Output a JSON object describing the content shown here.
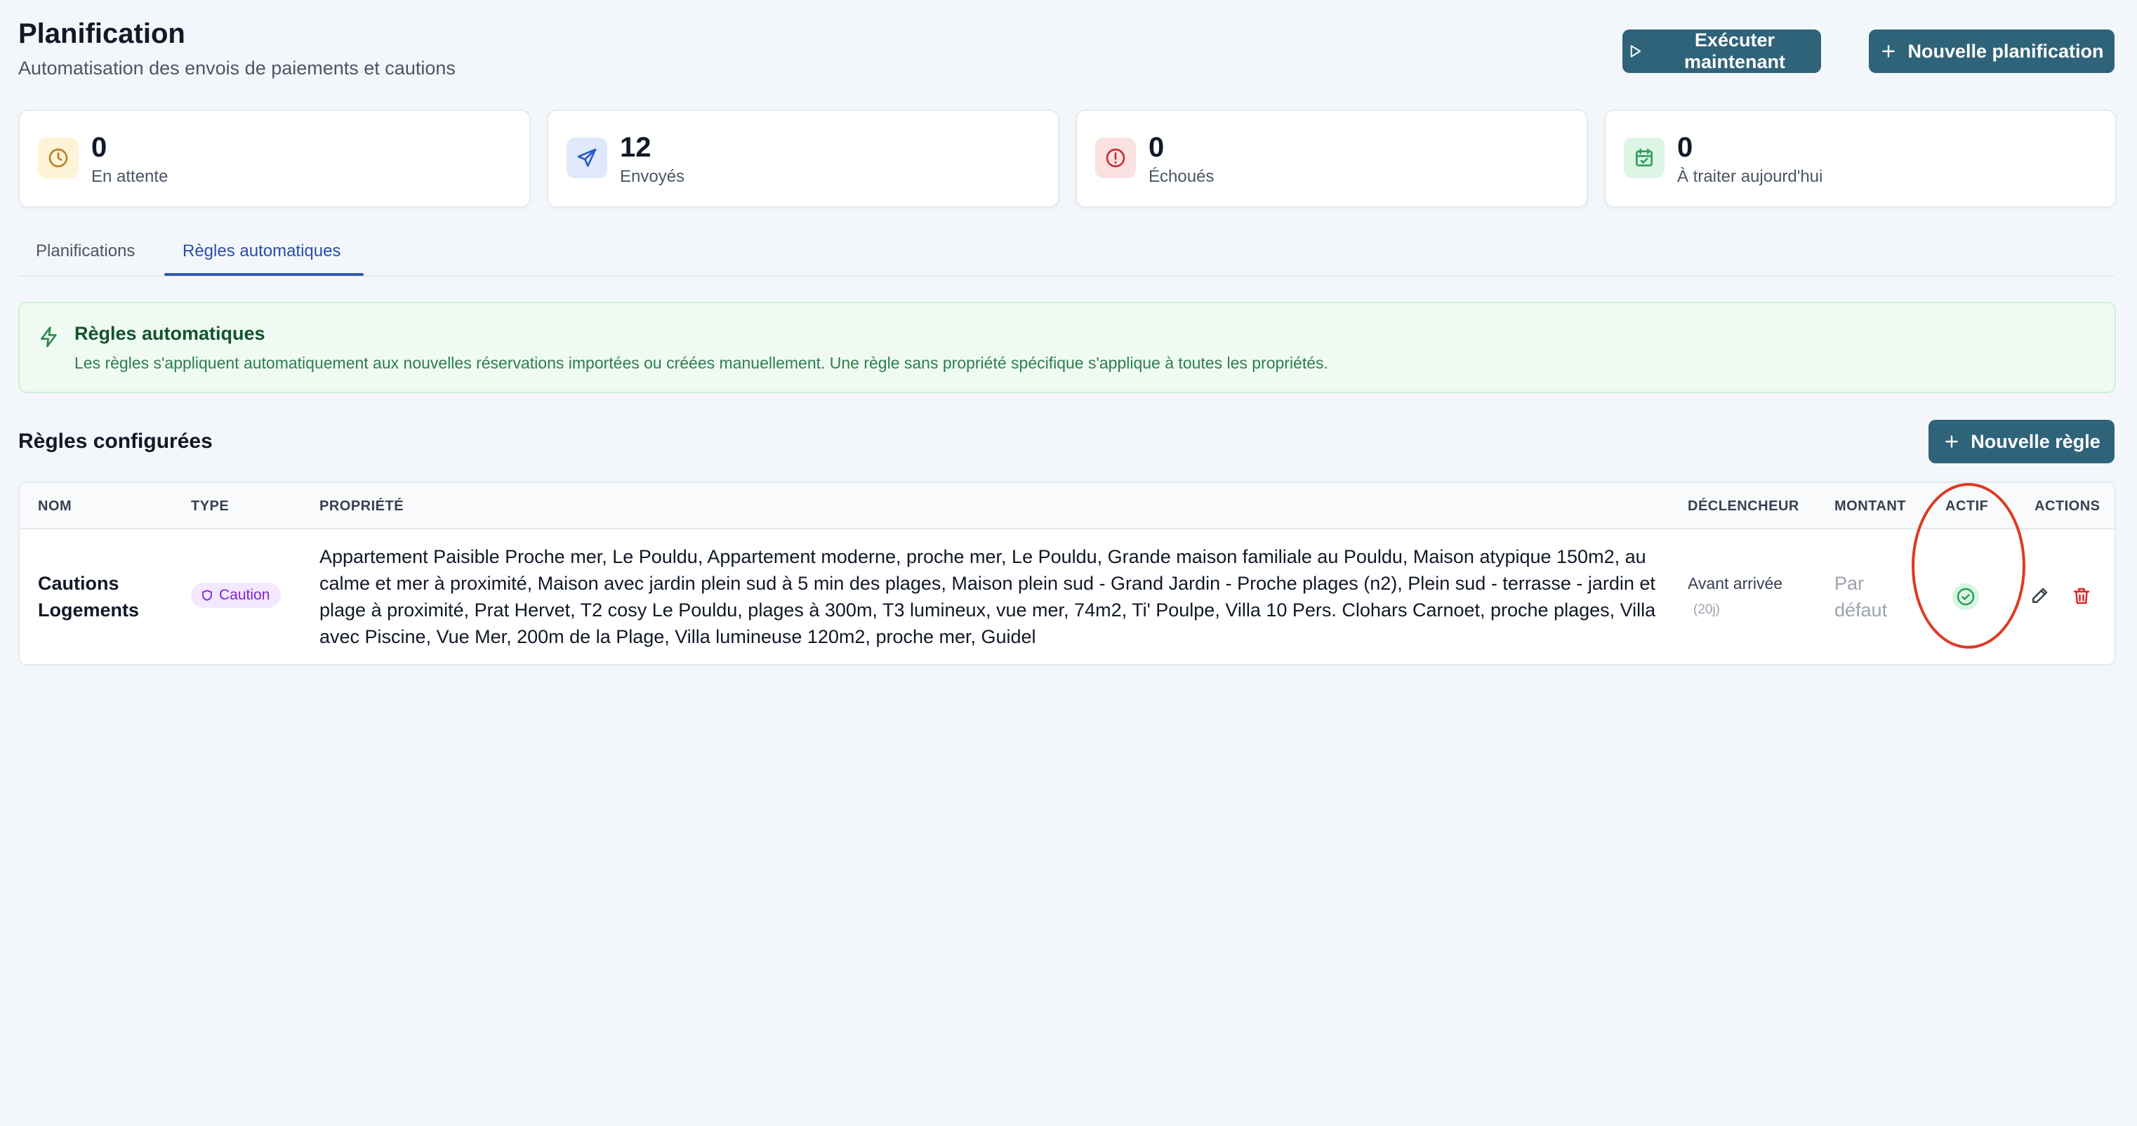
{
  "header": {
    "title": "Planification",
    "subtitle": "Automatisation des envois de paiements et cautions",
    "run_now_label": "Exécuter maintenant",
    "new_planning_label": "Nouvelle planification"
  },
  "stats": [
    {
      "value": "0",
      "label": "En attente",
      "icon": "clock-icon",
      "color": "#b9822b",
      "bg": "#fdf3d6"
    },
    {
      "value": "12",
      "label": "Envoyés",
      "icon": "send-icon",
      "color": "#2a5bbf",
      "bg": "#dfe9fb"
    },
    {
      "value": "0",
      "label": "Échoués",
      "icon": "alert-circle-icon",
      "color": "#c53030",
      "bg": "#fbe2e2"
    },
    {
      "value": "0",
      "label": "À traiter aujourd'hui",
      "icon": "calendar-check-icon",
      "color": "#2f9e5b",
      "bg": "#dcf5e5"
    }
  ],
  "tabs": {
    "planifications": "Planifications",
    "rules": "Règles automatiques",
    "active": "rules"
  },
  "banner": {
    "title": "Règles automatiques",
    "text": "Les règles s'appliquent automatiquement aux nouvelles réservations importées ou créées manuellement. Une règle sans propriété spécifique s'applique à toutes les propriétés."
  },
  "section": {
    "title": "Règles configurées",
    "new_rule_label": "Nouvelle règle"
  },
  "table": {
    "columns": [
      "NOM",
      "TYPE",
      "PROPRIÉTÉ",
      "DÉCLENCHEUR",
      "MONTANT",
      "ACTIF",
      "ACTIONS"
    ],
    "rows": [
      {
        "name": "Cautions Logements",
        "type": "Caution",
        "property": "Appartement Paisible Proche mer, Le Pouldu, Appartement moderne, proche mer, Le Pouldu, Grande maison familiale au Pouldu, Maison atypique 150m2, au calme et mer à proximité, Maison avec jardin plein sud à 5 min des plages, Maison plein sud - Grand Jardin - Proche plages (n2), Plein sud - terrasse - jardin et plage à proximité, Prat Hervet, T2 cosy Le Pouldu, plages à 300m, T3 lumineux, vue mer, 74m2, Ti' Poulpe, Villa 10 Pers. Clohars Carnoet, proche plages, Villa avec Piscine, Vue Mer, 200m de la Plage, Villa lumineuse 120m2, proche mer, Guidel",
        "trigger": "Avant arrivée",
        "trigger_days": "(20j)",
        "amount": "Par défaut",
        "active": true
      }
    ]
  },
  "colors": {
    "primary_button": "#2f6379",
    "active_tab": "#2f5bb7",
    "annotation_circle": "#dd3b22"
  }
}
